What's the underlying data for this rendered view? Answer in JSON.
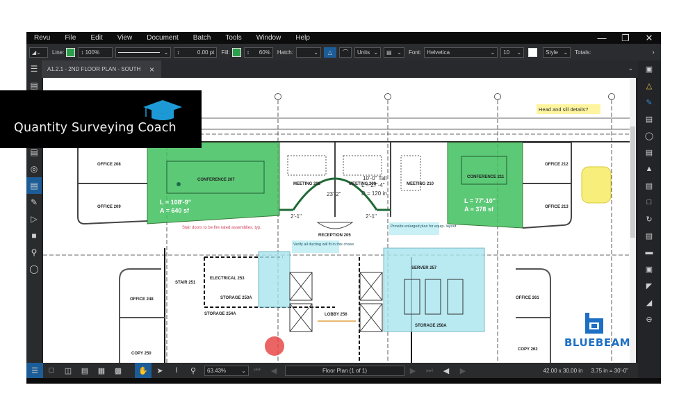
{
  "menu": {
    "items": [
      "Revu",
      "File",
      "Edit",
      "View",
      "Document",
      "Batch",
      "Tools",
      "Window",
      "Help"
    ],
    "window_controls": [
      "minimize",
      "restore",
      "close"
    ]
  },
  "toolbar": {
    "line_label": "Line:",
    "line_color": "#2aa04a",
    "line_opacity": "100%",
    "line_width": "0.00 pt",
    "fill_label": "Fill:",
    "fill_color": "#2aa04a",
    "fill_opacity": "60%",
    "hatch_label": "Hatch:",
    "hatch_value": "",
    "units_label": "Units",
    "font_label": "Font:",
    "font_value": "Helvetica",
    "font_size": "10",
    "style_label": "Style",
    "totals_label": "Totals:"
  },
  "tab": {
    "title": "A1.2.1 - 2ND FLOOR PLAN - SOUTH",
    "close": "×"
  },
  "watermark": {
    "text": "Quantity Surveying Coach",
    "accent": "#1d9ad6"
  },
  "brand": {
    "text": "BLUEBEAM",
    "color": "#1d6fc4"
  },
  "statusbar": {
    "zoom": "63.43%",
    "page": "Floor Plan (1 of 1)",
    "page_size": "42.00 x 30.00 in",
    "scale": "3.75 in = 30'-0\""
  },
  "plan": {
    "annotation_callout": "Head and sill details?",
    "note_doors": "Stair doors to be fire rated assemblies, typ.",
    "note_ducting": "Verify all ducting will fit in this chase",
    "note_equip": "Provide enlarged plan for equip. layout",
    "rooms": [
      {
        "name": "OFFICE 208"
      },
      {
        "name": "OFFICE 209"
      },
      {
        "name": "CONFERENCE 207"
      },
      {
        "name": "MEETING 208"
      },
      {
        "name": "MEETING 209"
      },
      {
        "name": "MEETING 210"
      },
      {
        "name": "CONFERENCE 211"
      },
      {
        "name": "OFFICE 212"
      },
      {
        "name": "OFFICE 213"
      },
      {
        "name": "RECEPTION 205"
      },
      {
        "name": "STAIR 251"
      },
      {
        "name": "ELECTRICAL 253"
      },
      {
        "name": "STORAGE 253A"
      },
      {
        "name": "STORAGE 254A"
      },
      {
        "name": "OFFICE 248"
      },
      {
        "name": "COPY 250"
      },
      {
        "name": "LOBBY 256"
      },
      {
        "name": "SERVER 257"
      },
      {
        "name": "STORAGE 258A"
      },
      {
        "name": "OFFICE 261"
      },
      {
        "name": "COPY 262"
      }
    ],
    "measure_conf207": {
      "length": "L = 108'-9\"",
      "area": "A = 640 sf"
    },
    "measure_conf211": {
      "length": "L = 77'-10\"",
      "area": "A = 378 sf"
    },
    "measure_arc": {
      "tall": "10'-0\" Tall",
      "length": "L = 27'-4\"",
      "depth": "D = 120 in"
    },
    "dim_arc": "23'-2\"",
    "dim_left": "2'-1\"",
    "dim_right": "2'-1\""
  }
}
